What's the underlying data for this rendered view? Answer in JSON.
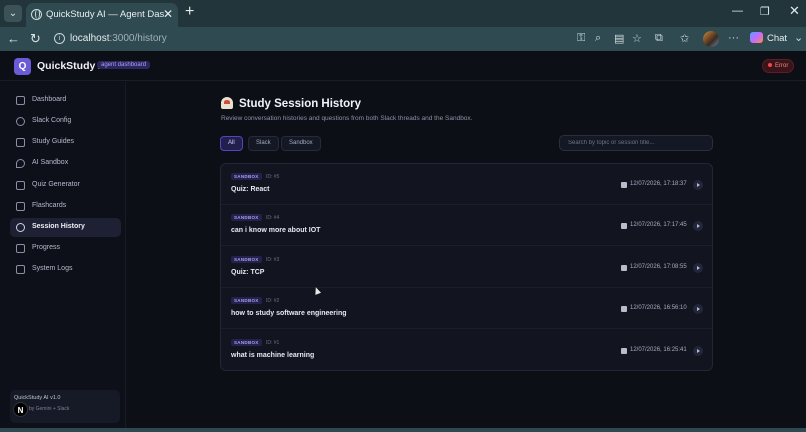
{
  "browser": {
    "tab_title": "QuickStudy AI — Agent Dashboard",
    "url_host": "localhost",
    "url_path": ":3000/history",
    "chat_label": "Chat"
  },
  "app": {
    "logo_letter": "Q",
    "name": "QuickStudy AI",
    "badge": "agent dashboard",
    "status": "Error",
    "status_color": "#f04a4a",
    "accent_color": "#6b5bd6"
  },
  "sidebar": {
    "items": [
      {
        "label": "Dashboard",
        "icon": "grid-icon"
      },
      {
        "label": "Slack Config",
        "icon": "gear-icon"
      },
      {
        "label": "Study Guides",
        "icon": "book-icon"
      },
      {
        "label": "AI Sandbox",
        "icon": "chat-icon"
      },
      {
        "label": "Quiz Generator",
        "icon": "clipboard-icon"
      },
      {
        "label": "Flashcards",
        "icon": "cards-icon"
      },
      {
        "label": "Session History",
        "icon": "clock-icon",
        "active": true
      },
      {
        "label": "Progress",
        "icon": "bar-chart-icon"
      },
      {
        "label": "System Logs",
        "icon": "terminal-icon"
      }
    ],
    "footer_title": "QuickStudy AI v1.0",
    "footer_sub": "ed by Gemini + Slack",
    "avatar_letter": "N"
  },
  "main": {
    "title": "Study Session History",
    "subtitle": "Review conversation histories and questions from both Slack threads and the Sandbox.",
    "filters": [
      "All",
      "Slack",
      "Sandbox"
    ],
    "active_filter": "All",
    "search_placeholder": "Search by topic or session title...",
    "sessions": [
      {
        "source": "SANDBOX",
        "id": "ID: #5",
        "title": "Quiz: React",
        "date": "12/07/2026, 17:18:37"
      },
      {
        "source": "SANDBOX",
        "id": "ID: #4",
        "title": "can i know more about IOT",
        "date": "12/07/2026, 17:17:45"
      },
      {
        "source": "SANDBOX",
        "id": "ID: #3",
        "title": "Quiz: TCP",
        "date": "12/07/2026, 17:08:55"
      },
      {
        "source": "SANDBOX",
        "id": "ID: #2",
        "title": "how to study software engineering",
        "date": "12/07/2026, 16:56:10"
      },
      {
        "source": "SANDBOX",
        "id": "ID: #1",
        "title": "what is machine learning",
        "date": "12/07/2026, 16:25:41"
      }
    ]
  }
}
